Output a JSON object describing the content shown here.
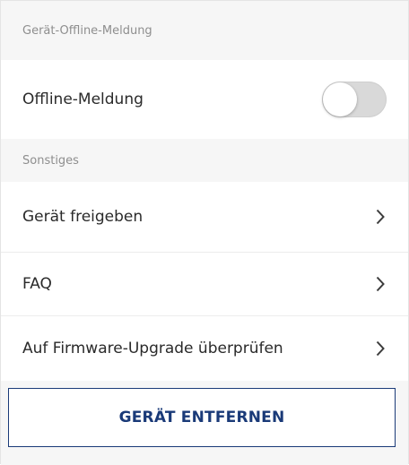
{
  "offline_section": {
    "header": "Gerät-Offline-Meldung",
    "offline_label": "Offline-Meldung",
    "offline_toggle_state": "off"
  },
  "other_section": {
    "header": "Sonstiges",
    "items": [
      {
        "label": "Gerät freigeben",
        "icon": "chevron-right-icon"
      },
      {
        "label": "FAQ",
        "icon": "chevron-right-icon"
      },
      {
        "label": "Auf Firmware-Upgrade überprüfen",
        "icon": "chevron-right-icon"
      }
    ]
  },
  "actions": {
    "remove_label": "GERÄT ENTFERNEN"
  },
  "colors": {
    "accent": "#1a3a78",
    "background": "#f6f6f6",
    "row_background": "#ffffff",
    "section_text": "#8e8e8e",
    "toggle_off": "#d9d9d9"
  }
}
